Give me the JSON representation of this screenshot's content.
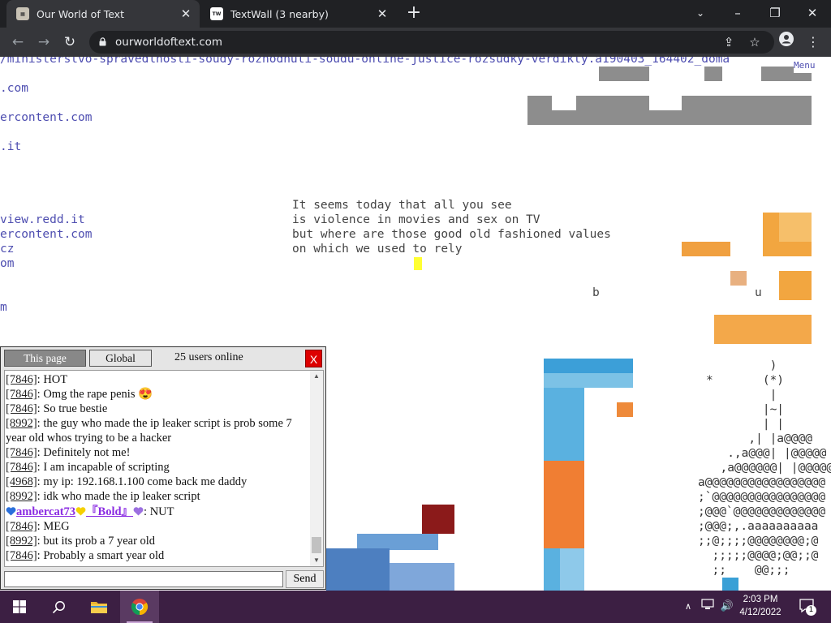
{
  "browser": {
    "tabs": [
      {
        "title": "Our World of Text",
        "active": true
      },
      {
        "title": "TextWall (3 nearby)",
        "active": false
      }
    ],
    "url": "ourworldoftext.com"
  },
  "page": {
    "top_link": "/ministerstvo-spravedlnosti-soudy-rozhodnuti-soudu-online-justice-rozsudky-verdikty.a190403_164402_doma",
    "menu_label": "Menu",
    "link_fragments": [
      ".com",
      "ercontent.com",
      ".it",
      "view.redd.it",
      "ercontent.com",
      "cz",
      "om",
      "m"
    ],
    "poem_lines": [
      "It seems today that all you see",
      "is violence in movies and sex on TV",
      "but where are those good old fashioned values",
      "on which we used to rely"
    ],
    "stray_chars": [
      "b",
      "u"
    ],
    "ascii_art": [
      "         )",
      "*       (*)",
      "         |",
      "        |~|",
      "        | |",
      "      ,| |a@@@@",
      "   .,a@@@| |@@@@@",
      "  ,a@@@@@@| |@@@@@",
      "a@@@@@@@@@@@@@@@@@",
      ";`@@@@@@@@@@@@@@@@",
      ";@@@`@@@@@@@@@@@@@",
      ";@@@;,.aaaaaaaaaa",
      ";;@;;;;@@@@@@@@;@",
      "  ;;;;;@@@@;@@;;@",
      "  ;;    @@;;;"
    ]
  },
  "chat": {
    "tab_this_page": "This page",
    "tab_global": "Global",
    "users_online": "25 users online",
    "close_label": "X",
    "send_label": "Send",
    "messages": [
      {
        "id": "[7846]",
        "text": ": HOT"
      },
      {
        "id": "[7846]",
        "text": ": Omg the rape penis 😍"
      },
      {
        "id": "[7846]",
        "text": ": So true bestie"
      },
      {
        "id": "[8992]",
        "text": ": the guy who made the ip leaker script is prob some 7 year old whos trying to be a hacker"
      },
      {
        "id": "[7846]",
        "text": ": Definitely not me!"
      },
      {
        "id": "[7846]",
        "text": ": I am incapable of scripting"
      },
      {
        "id": "[4968]",
        "text": ": my ip: 192.168.1.100 come back me daddy"
      },
      {
        "id": "[8992]",
        "text": ": idk who made the ip leaker script"
      },
      {
        "id": "",
        "user": "ambercat73",
        "badge": "『Bold』",
        "text": ": NUT"
      },
      {
        "id": "[7846]",
        "text": ": MEG"
      },
      {
        "id": "[8992]",
        "text": ": but its prob a 7 year old"
      },
      {
        "id": "[7846]",
        "text": ": Probably a smart year old"
      }
    ]
  },
  "taskbar": {
    "time": "2:03 PM",
    "date": "4/12/2022",
    "notification_count": "1"
  },
  "colors": {
    "tab_bar": "#202124",
    "toolbar": "#35363a",
    "link": "#4d4db0",
    "taskbar": "#3c1f43",
    "username": "#8a2be2",
    "chat_close": "#dd0000"
  }
}
